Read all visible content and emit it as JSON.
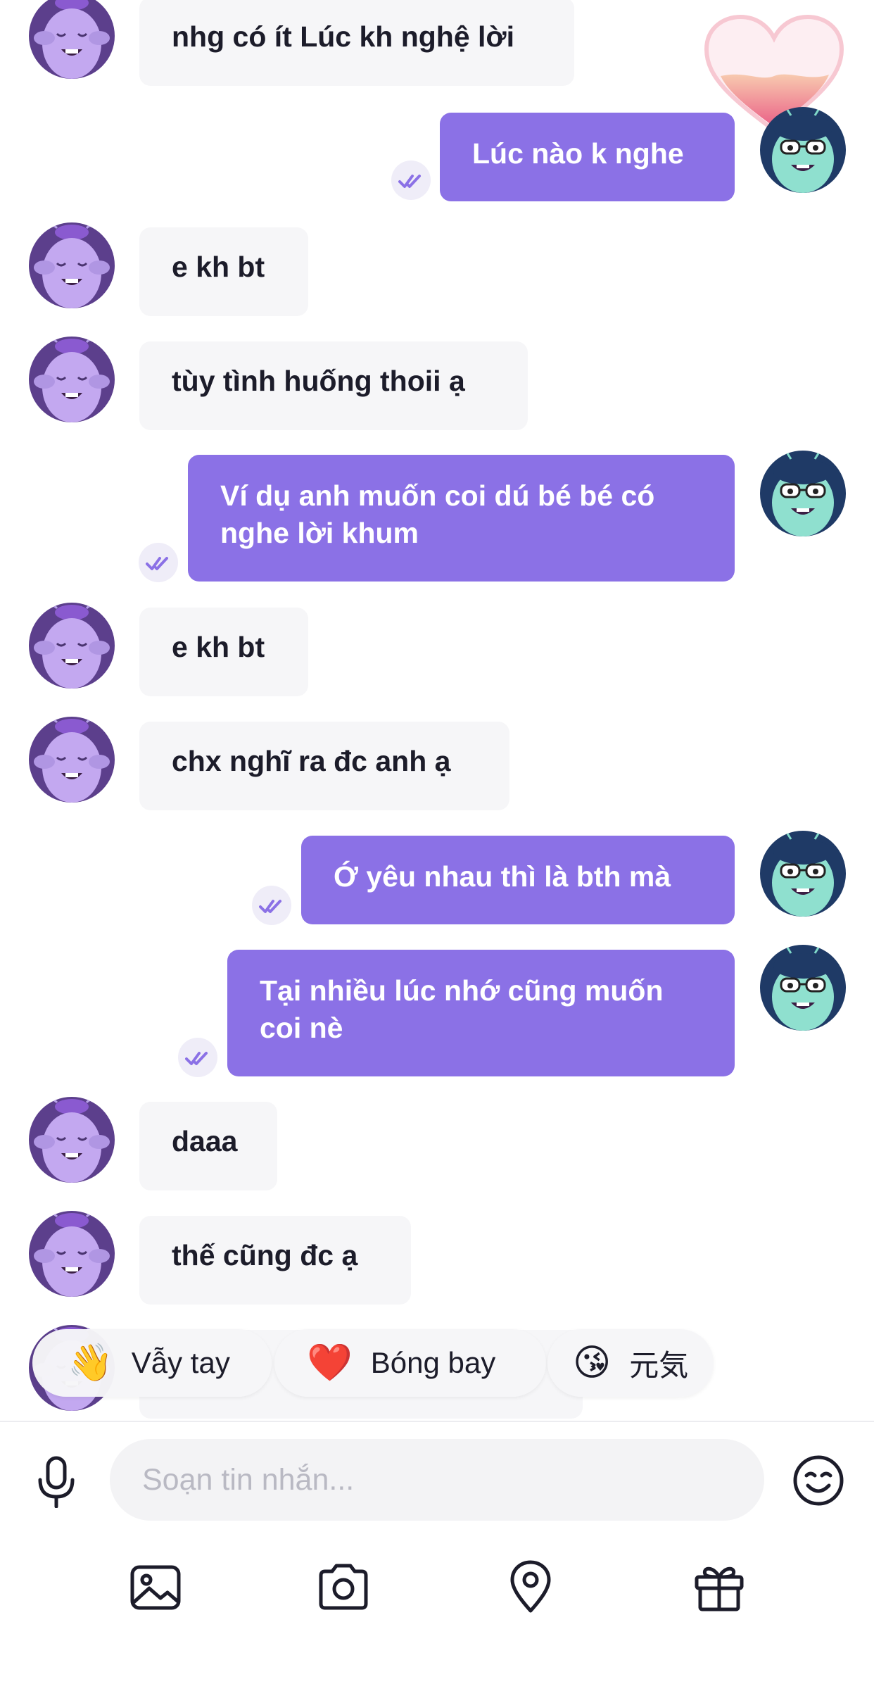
{
  "messages": [
    {
      "from": "them",
      "text": "nhg có ít Lúc kh nghệ lời"
    },
    {
      "from": "me",
      "text": "Lúc nào k nghe"
    },
    {
      "from": "them",
      "text": "e kh bt"
    },
    {
      "from": "them",
      "text": "tùy tình huống thoii ạ"
    },
    {
      "from": "me",
      "text": "Ví dụ anh muốn coi dú bé bé có nghe lời khum"
    },
    {
      "from": "them",
      "text": "e kh bt"
    },
    {
      "from": "them",
      "text": "chx nghĩ ra đc anh ạ"
    },
    {
      "from": "me",
      "text": "Ớ yêu nhau thì là bth mà"
    },
    {
      "from": "me",
      "text": "Tại nhiều lúc nhớ cũng muốn coi nè"
    },
    {
      "from": "them",
      "text": "daaa"
    },
    {
      "from": "them",
      "text": "thế cũng đc ạ"
    }
  ],
  "quick_reactions": [
    {
      "emoji": "👋",
      "label": "Vẫy tay"
    },
    {
      "emoji": "❤️",
      "label": "Bóng bay"
    },
    {
      "emoji": "😘",
      "label": "元気"
    }
  ],
  "composer": {
    "placeholder": "Soạn tin nhắn...",
    "icons": [
      "microphone-icon",
      "emoji-icon",
      "image-icon",
      "camera-icon",
      "location-icon",
      "gift-icon"
    ]
  },
  "colors": {
    "outgoing_bubble": "#8b71e6",
    "incoming_bubble": "#f6f6f8",
    "read_tick": "#8b71e6"
  }
}
